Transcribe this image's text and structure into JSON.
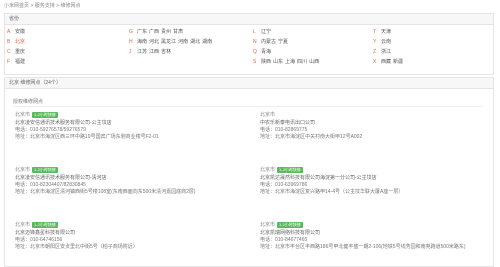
{
  "breadcrumb": {
    "home": "小米网首页",
    "sep1": ">",
    "service": "服务支持",
    "sep2": ">",
    "current": "维修网点"
  },
  "province_panel": {
    "title": "省份",
    "rows": [
      [
        {
          "letter": "A",
          "cities": [
            "安徽"
          ]
        },
        {
          "letter": "G",
          "cities": [
            "广东",
            "广西",
            "贵州",
            "甘肃"
          ]
        },
        {
          "letter": "L",
          "cities": [
            "辽宁"
          ]
        },
        {
          "letter": "T",
          "cities": [
            "天津"
          ]
        }
      ],
      [
        {
          "letter": "B",
          "cities": [
            "北京"
          ],
          "active": 0
        },
        {
          "letter": "H",
          "cities": [
            "海南",
            "河北",
            "黑龙江",
            "河南",
            "湖北",
            "湖南"
          ]
        },
        {
          "letter": "N",
          "cities": [
            "内蒙古",
            "宁夏"
          ]
        },
        {
          "letter": "Y",
          "cities": [
            "云南"
          ]
        }
      ],
      [
        {
          "letter": "C",
          "cities": [
            "重庆"
          ]
        },
        {
          "letter": "J",
          "cities": [
            "江苏",
            "江西",
            "吉林"
          ]
        },
        {
          "letter": "Q",
          "cities": [
            "青海"
          ]
        },
        {
          "letter": "Z",
          "cities": [
            "浙江"
          ]
        }
      ],
      [
        {
          "letter": "F",
          "cities": [
            "福建"
          ]
        },
        {
          "letter": "",
          "cities": []
        },
        {
          "letter": "S",
          "cities": [
            "陕西",
            "山东",
            "上海",
            "四川",
            "山西"
          ]
        },
        {
          "letter": "X",
          "cities": [
            "西藏",
            "新疆"
          ]
        }
      ]
    ]
  },
  "main_panel": {
    "title": "北京 维修网点（24个）",
    "sub_tab": "授权维修网点",
    "stores": [
      {
        "city": "北京市",
        "badge": "1-2小时快修",
        "name": "北京凌安信通讯技术服务有限公司-公主坟店",
        "phone": "电话：010-59276578/59276579",
        "address": "地址：北京市海淀区西三环中路19号国宾广场东侧商业楼号F2-01"
      },
      {
        "city": "北京市",
        "badge": "",
        "name": "中农乐新泰电讯出口公司",
        "phone": "电话：010-82869775",
        "address": "地址：北京市海淀区中关村南大街甲12号A002"
      },
      {
        "city": "北京市",
        "badge": "1-2小时快修",
        "name": "北京凌安信通讯技术服务有限公司-清河店",
        "phone": "电话：010-82304407/82830845",
        "address": "地址：北京市海淀区清河镇西街5号楼108室(东南西面向东500米清河嘉园底商2层)"
      },
      {
        "city": "北京市",
        "badge": "1-2小时快修",
        "name": "北京凯达晟然科技有限公司海淀第一分公司-公主坟店",
        "phone": "电话：010-63969786",
        "address": "地址：北京市海淀区复兴路甲14-4号（公主坟华联大厦A座一层）"
      },
      {
        "city": "北京市",
        "badge": "1-2小时快修",
        "name": "北京迈锋鑫星科技有限公司",
        "phone": "电话：010-64746156",
        "address": "地址：北京市朝阳区安贞里北中街5号（柏子商场附近）"
      },
      {
        "city": "北京市",
        "badge": "1-2小时快修",
        "name": "北京凯瑞网络科技有限公司",
        "phone": "电话：010-84677465",
        "address": "地址：北京市丰台区丰西路186号甲北健丰盛一期2-106(地铁5号线芳园和南苑跑道500米路东)"
      }
    ]
  }
}
